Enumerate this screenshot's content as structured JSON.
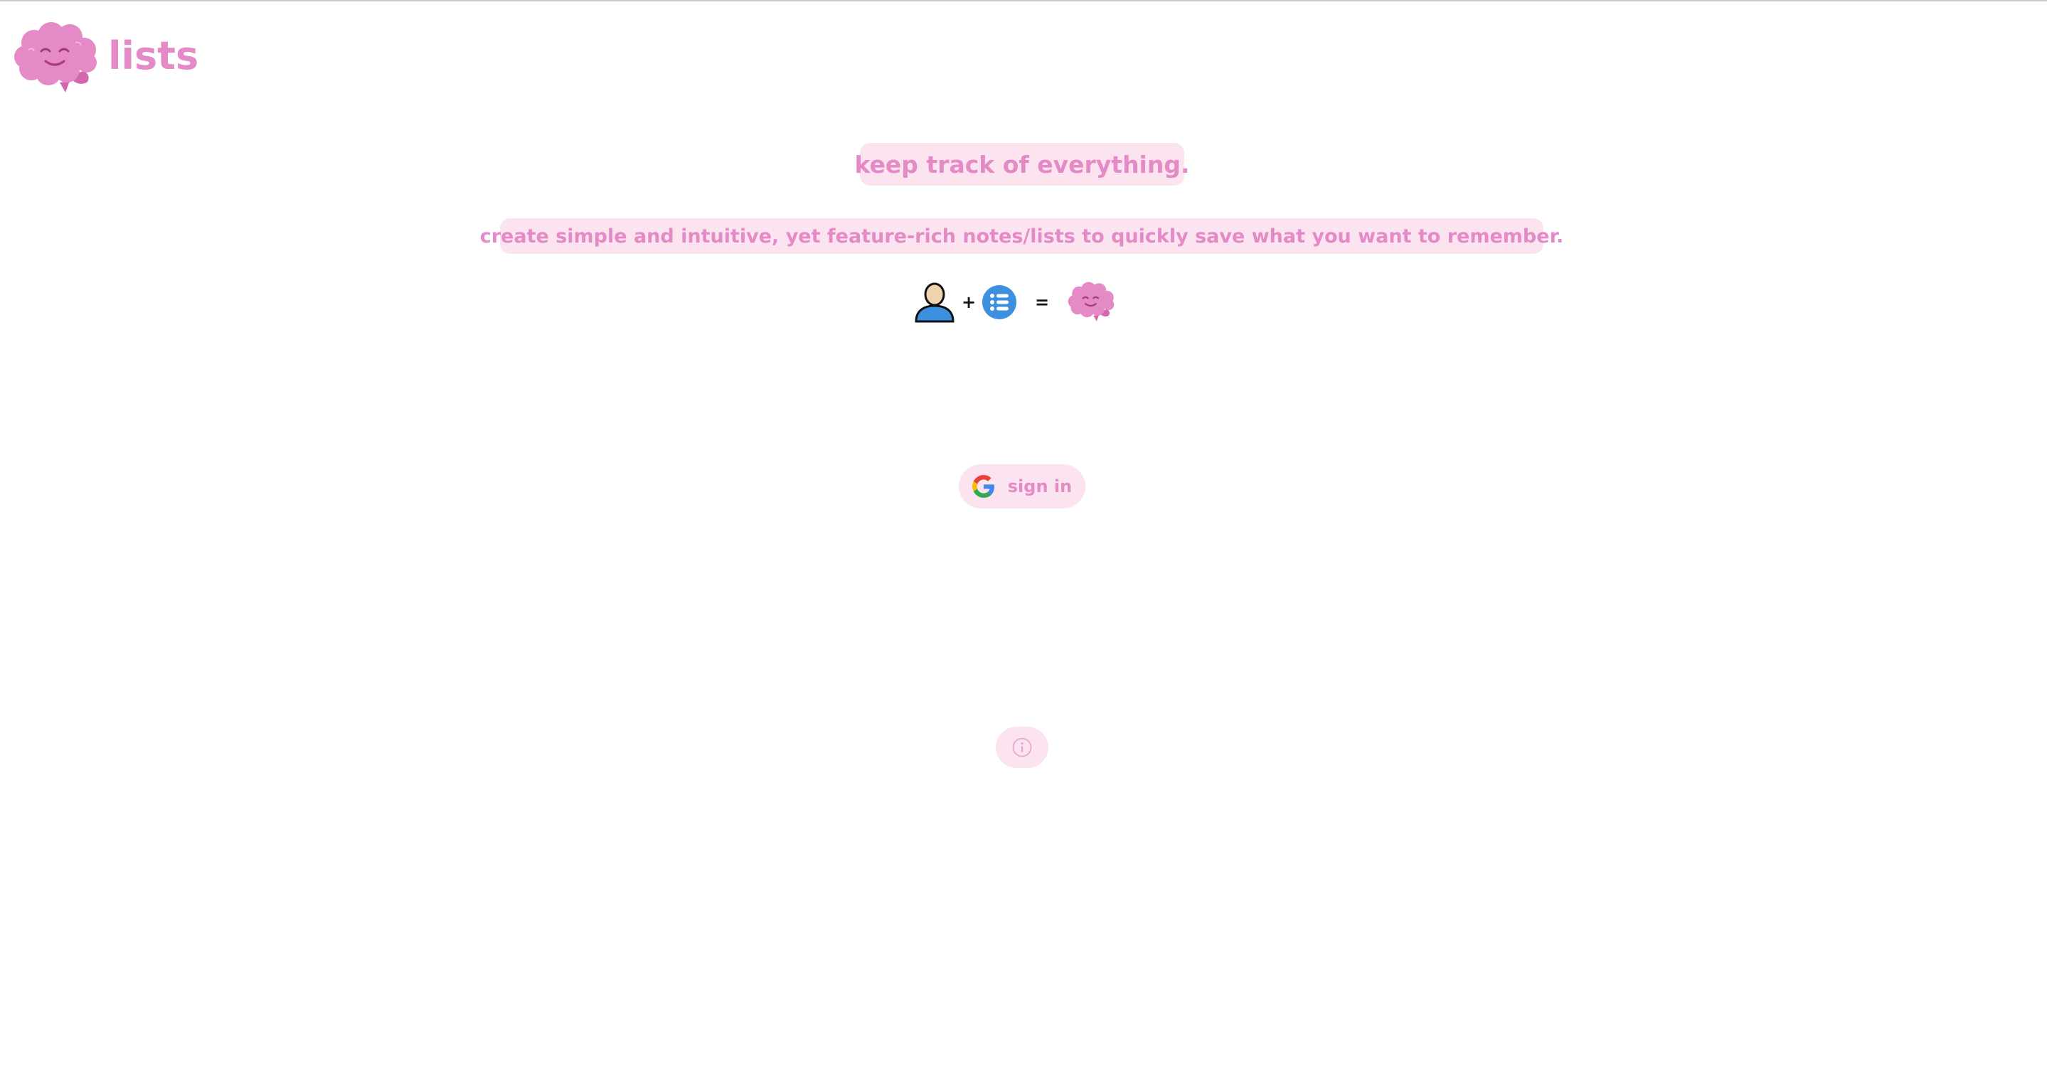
{
  "brand": {
    "logo_icon": "smiling-brain-icon",
    "name": "lists"
  },
  "hero": {
    "headline": "keep track of everything.",
    "subheadline": "create simple and intuitive, yet feature-rich notes/lists to quickly save what you want to remember.",
    "equation": {
      "items": [
        "person-icon",
        "list-icon",
        "smiling-brain-icon"
      ],
      "plus": "+",
      "equals": "="
    }
  },
  "auth": {
    "signin_label": "sign in",
    "provider_icon": "google-icon"
  },
  "info": {
    "icon": "info-circle-icon"
  },
  "colors": {
    "accent": "#e48ac6",
    "pill_bg": "#fbe4ef",
    "brain_pink": "#e48ac6",
    "brain_shade": "#d467ad",
    "list_blue": "#3d8fe0",
    "person_blue": "#3d8fe0",
    "person_skin": "#efd3ae"
  }
}
